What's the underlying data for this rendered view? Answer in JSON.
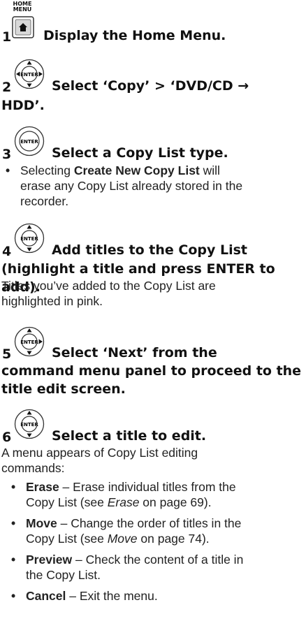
{
  "step1": {
    "number": "1",
    "button_label": "HOME\nMENU",
    "button_label_l1": "HOME",
    "button_label_l2": "MENU",
    "icon": "home-menu-button-icon",
    "heading": "Display the Home Menu."
  },
  "step2": {
    "number": "2",
    "icon": "enter-4way-joystick-icon",
    "icon_text": "ENTER",
    "heading_l1": "Select ‘Copy’ > ‘DVD/CD →",
    "heading_l2": "HDD’."
  },
  "step3": {
    "number": "3",
    "icon": "enter-button-icon",
    "icon_text": "ENTER",
    "heading": "Select a Copy List type.",
    "note_pre": "Selecting ",
    "note_bold": "Create New Copy List",
    "note_post_l1": " will",
    "note_l2": "erase any Copy List already stored in the",
    "note_l3": "recorder."
  },
  "step4": {
    "number": "4",
    "icon": "enter-updown-joystick-icon",
    "icon_text": "ENTER",
    "heading_l1": "Add titles to the Copy List",
    "heading_l2": "(highlight a title and press ENTER to add).",
    "body_l1": "Titles you’ve added to the Copy List are",
    "body_l2": "highlighted in pink."
  },
  "step5": {
    "number": "5",
    "icon": "enter-3way-joystick-icon",
    "icon_text": "ENTER",
    "heading_l1": "Select ‘Next’ from the",
    "heading_l2": "command menu panel to proceed to the",
    "heading_l3": "title edit screen."
  },
  "step6": {
    "number": "6",
    "icon": "enter-updown-joystick-icon",
    "icon_text": "ENTER",
    "heading": "Select a title to edit.",
    "body_l1": "A menu appears of Copy List editing",
    "body_l2": "commands:",
    "items": [
      {
        "term": "Erase",
        "l1": " – Erase individual titles from the",
        "l2_pre": "Copy List (see ",
        "l2_ital": "Erase",
        "l2_post": " on page 69)."
      },
      {
        "term": "Move",
        "l1": " – Change the order of titles in the",
        "l2_pre": "Copy List (see ",
        "l2_ital": "Move",
        "l2_post": " on page 74)."
      },
      {
        "term": "Preview",
        "l1": " – Check the content of a title in",
        "l2_pre": "the Copy List.",
        "l2_ital": "",
        "l2_post": ""
      },
      {
        "term": "Cancel",
        "l1": " – Exit the menu.",
        "l2_pre": "",
        "l2_ital": "",
        "l2_post": ""
      }
    ]
  }
}
